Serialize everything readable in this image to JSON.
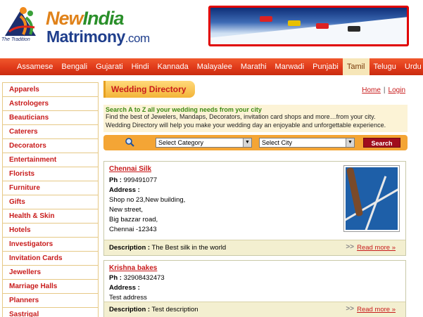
{
  "header": {
    "tagline": "The Tradition",
    "brand_new": "New",
    "brand_india": "India",
    "brand_matrimony": "Matrimony",
    "brand_com": ".com"
  },
  "languages": [
    "Assamese",
    "Bengali",
    "Gujarati",
    "Hindi",
    "Kannada",
    "Malayalee",
    "Marathi",
    "Marwadi",
    "Punjabi",
    "Tamil",
    "Telugu",
    "Urdu"
  ],
  "active_language": "Tamil",
  "sidebar": {
    "items": [
      "Apparels",
      "Astrologers",
      "Beauticians",
      "Caterers",
      "Decorators",
      "Entertainment",
      "Florists",
      "Furniture",
      "Gifts",
      "Health & Skin",
      "Hotels",
      "Investigators",
      "Invitation Cards",
      "Jewellers",
      "Marriage Halls",
      "Planners",
      "Sastrigal"
    ]
  },
  "main": {
    "directory_title": "Wedding Directory",
    "home_link": "Home",
    "separator": "|",
    "login_link": "Login",
    "intro_heading": "Search A to Z all your wedding needs from your city",
    "intro_line1": "Find the best of Jewelers, Mandaps, Decorators, invitation card shops and more…from your city.",
    "intro_line2": "Wedding Directory will help you make your wedding day an enjoyable and unforgettable experience.",
    "category_select": "Select Category",
    "city_select": "Select City",
    "search_button": "Search"
  },
  "listings": [
    {
      "name": "Chennai Silk",
      "ph_label": "Ph :",
      "phone": "999491077",
      "address_label": "Address :",
      "address_lines": [
        "Shop no 23,New building,",
        "New street,",
        "Big bazzar road,",
        "Chennai -12343"
      ],
      "desc_label": "Description :",
      "description": "The Best silk in the world",
      "more_arrows": ">>",
      "more": "Read more »"
    },
    {
      "name": "Krishna bakes",
      "ph_label": "Ph :",
      "phone": "32908432473",
      "address_label": "Address :",
      "address_lines": [
        "Test address"
      ],
      "desc_label": "Description :",
      "description": "Test description",
      "more_arrows": ">>",
      "more": "Read more »"
    }
  ],
  "colors": {
    "nav_red": "#e03a1a",
    "link_red": "#c81b1b",
    "accent_orange": "#f4a535",
    "intro_green": "#3e8a16"
  }
}
